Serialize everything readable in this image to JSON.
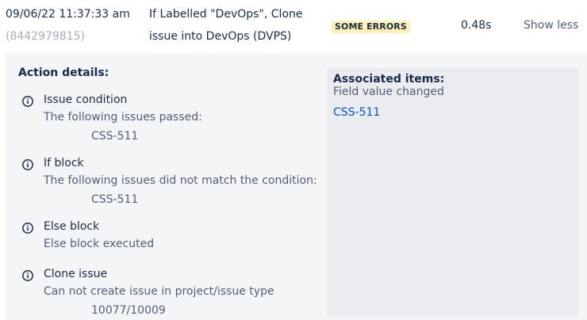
{
  "row": {
    "timestamp": "09/06/22 11:37:33 am",
    "run_id": "(8442979815)",
    "rule_name": "If Labelled \"DevOps\", Clone issue into DevOps (DVPS)",
    "status": "SOME ERRORS",
    "duration": "0.48s",
    "toggle_label": "Show less"
  },
  "details": {
    "title": "Action details:",
    "actions": [
      {
        "icon": "info-icon",
        "title": "Issue condition",
        "description": "The following issues passed:",
        "item": "CSS-511"
      },
      {
        "icon": "info-icon",
        "title": "If block",
        "description": "The following issues did not match the condition:",
        "item": "CSS-511"
      },
      {
        "icon": "info-icon",
        "title": "Else block",
        "description": "Else block executed",
        "item": ""
      },
      {
        "icon": "info-icon",
        "title": "Clone issue",
        "description": "Can not create issue in project/issue type",
        "item": "10077/10009"
      }
    ]
  },
  "associated": {
    "title": "Associated items:",
    "subtitle": "Field value changed",
    "link": "CSS-511"
  },
  "colors": {
    "badge_bg": "#fff0b3",
    "panel_bg": "#f4f5f7",
    "link": "#0052cc"
  }
}
